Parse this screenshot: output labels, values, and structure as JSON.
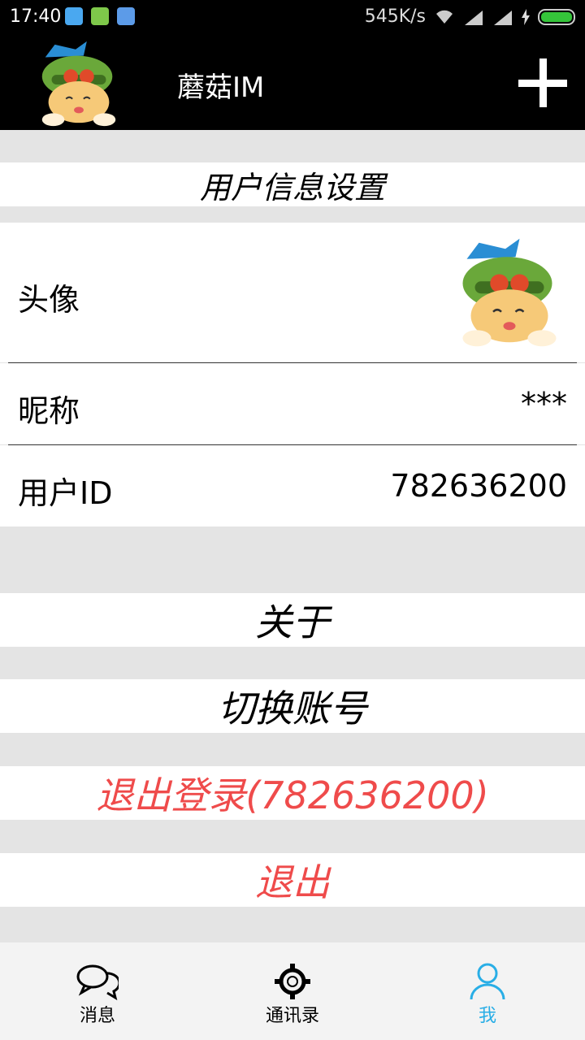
{
  "status_bar": {
    "time": "17:40",
    "speed": "545K/s"
  },
  "app_bar": {
    "title": "蘑菇IM"
  },
  "settings": {
    "section_title": "用户信息设置",
    "avatar_label": "头像",
    "nickname_label": "昵称",
    "nickname_value": "***",
    "user_id_label": "用户ID",
    "user_id_value": "782636200"
  },
  "actions": {
    "about": "关于",
    "switch_account": "切换账号",
    "logout": "退出登录(782636200)",
    "exit": "退出"
  },
  "tabs": [
    {
      "label": "消息",
      "icon": "chat-icon"
    },
    {
      "label": "通讯录",
      "icon": "gear-icon"
    },
    {
      "label": "我",
      "icon": "user-icon"
    }
  ],
  "colors": {
    "danger": "#ef4b4b",
    "active": "#29aee6"
  }
}
